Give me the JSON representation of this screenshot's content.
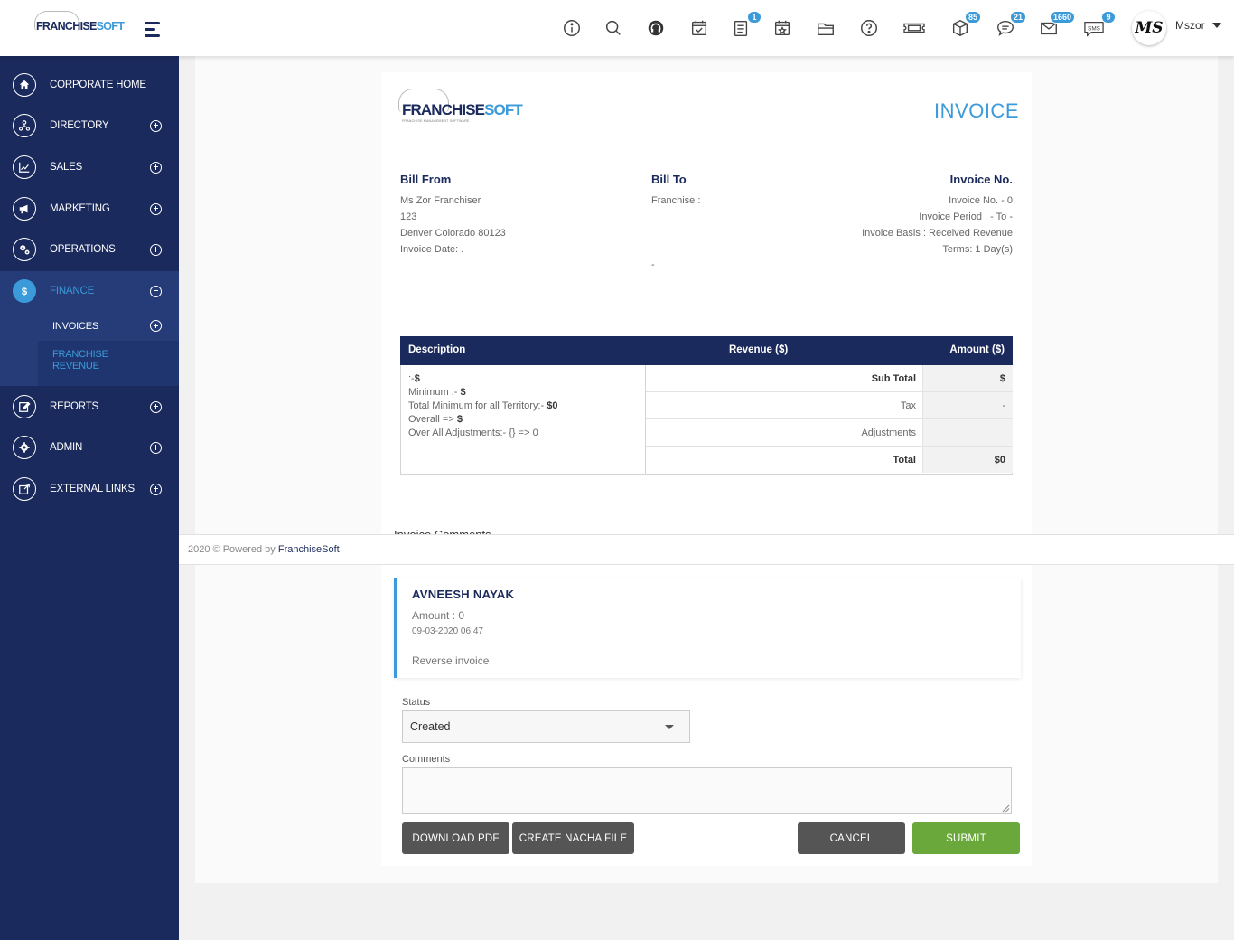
{
  "topbar": {
    "logo_main": "FRANCHISE",
    "logo_accent": "SOFT",
    "badges": {
      "tasks": "1",
      "inventory": "85",
      "chat": "21",
      "mail": "1660",
      "sms": "9"
    },
    "sms_label": "SMS",
    "avatar_initials": "MS",
    "username": "Mszor"
  },
  "sidebar": {
    "items": [
      {
        "label": "CORPORATE HOME",
        "icon": "home-icon"
      },
      {
        "label": "DIRECTORY",
        "icon": "directory-icon"
      },
      {
        "label": "SALES",
        "icon": "chart-icon"
      },
      {
        "label": "MARKETING",
        "icon": "megaphone-icon"
      },
      {
        "label": "OPERATIONS",
        "icon": "gears-icon"
      },
      {
        "label": "FINANCE",
        "icon": "dollar-icon"
      },
      {
        "label": "REPORTS",
        "icon": "edit-icon"
      },
      {
        "label": "ADMIN",
        "icon": "gear-icon"
      },
      {
        "label": "EXTERNAL LINKS",
        "icon": "external-link-icon"
      }
    ],
    "finance_sub": {
      "invoices": "INVOICES",
      "franchise_revenue_line1": "FRANCHISE",
      "franchise_revenue_line2": "REVENUE"
    }
  },
  "invoice": {
    "logo_main": "FRANCHISE",
    "logo_accent": "SOFT",
    "logo_tagline": "FRANCHISE MANAGEMENT SOFTWARE",
    "title": "INVOICE",
    "bill_from": {
      "heading": "Bill From",
      "name": "Ms Zor Franchiser",
      "street": "123",
      "city": "Denver Colorado 80123",
      "invoice_date": "Invoice Date: ."
    },
    "bill_to": {
      "heading": "Bill To",
      "franchise": "Franchise :",
      "dash": "-"
    },
    "invoice_no": {
      "heading": "Invoice No.",
      "number": "Invoice No. - 0",
      "period": "Invoice Period : - To -",
      "basis": "Invoice Basis : Received Revenue",
      "terms": "Terms: 1 Day(s)"
    },
    "table": {
      "headers": {
        "description": "Description",
        "revenue": "Revenue ($)",
        "amount": "Amount ($)"
      },
      "desc_lines": [
        {
          "text": ":-",
          "bold": "$"
        },
        {
          "text": "Minimum :- ",
          "bold": "$"
        },
        {
          "text": "Total Minimum for all Territory:- ",
          "bold": "$0"
        },
        {
          "text": "Overall => ",
          "bold": "$"
        },
        {
          "text": "Over All Adjustments:- {} => 0",
          "bold": ""
        }
      ],
      "summary": [
        {
          "label": "Sub Total",
          "value": "$"
        },
        {
          "label": "Tax",
          "value": "-"
        },
        {
          "label": "Adjustments",
          "value": ""
        },
        {
          "label": "Total",
          "value": "$0"
        }
      ]
    },
    "clipped_heading": "Invoice Comments"
  },
  "footer": {
    "text": "2020 © Powered by ",
    "brand": "FranchiseSoft"
  },
  "comment": {
    "author": "AVNEESH NAYAK",
    "amount": "Amount : 0",
    "date": "09-03-2020 06:47",
    "note": "Reverse invoice"
  },
  "form": {
    "status_label": "Status",
    "status_value": "Created",
    "comments_label": "Comments",
    "comments_value": ""
  },
  "buttons": {
    "download_pdf": "DOWNLOAD PDF",
    "create_nacha": "CREATE NACHA FILE",
    "cancel": "CANCEL",
    "submit": "SUBMIT"
  },
  "colors": {
    "navy": "#1b2a5c",
    "accent": "#3b9ad9",
    "submit": "#6aa83c"
  }
}
